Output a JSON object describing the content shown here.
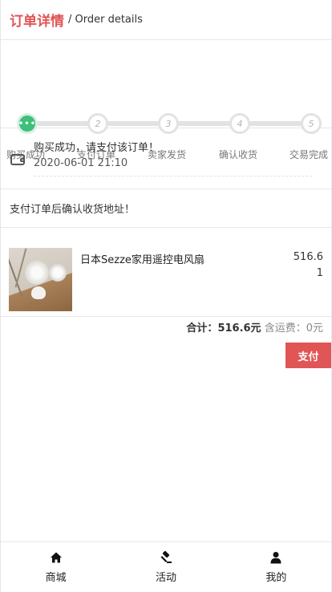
{
  "header": {
    "title": "订单详情",
    "subtitle": "/ Order details"
  },
  "steps": [
    {
      "label": "购买成功",
      "marker": "•••",
      "active": true
    },
    {
      "label": "支付订单",
      "marker": "2",
      "active": false
    },
    {
      "label": "卖家发货",
      "marker": "3",
      "active": false
    },
    {
      "label": "确认收货",
      "marker": "4",
      "active": false
    },
    {
      "label": "交易完成",
      "marker": "5",
      "active": false
    }
  ],
  "status": {
    "message": "购买成功，请支付该订单！",
    "time": "2020-06-01 21:10",
    "icon": "wallet-icon"
  },
  "address_notice": "支付订单后确认收货地址！",
  "item": {
    "name": "日本Sezze家用遥控电风扇",
    "price": "516.6",
    "qty": "1"
  },
  "summary": {
    "total_label": "合计：",
    "total_value": "516.6元",
    "shipping_label": "含运费：",
    "shipping_value": "0元"
  },
  "pay_button": "支付",
  "tabbar": [
    {
      "label": "商城",
      "icon": "home-icon"
    },
    {
      "label": "活动",
      "icon": "gavel-icon"
    },
    {
      "label": "我的",
      "icon": "user-icon"
    }
  ],
  "colors": {
    "accent": "#e05555",
    "active_step": "#3cc07a"
  }
}
